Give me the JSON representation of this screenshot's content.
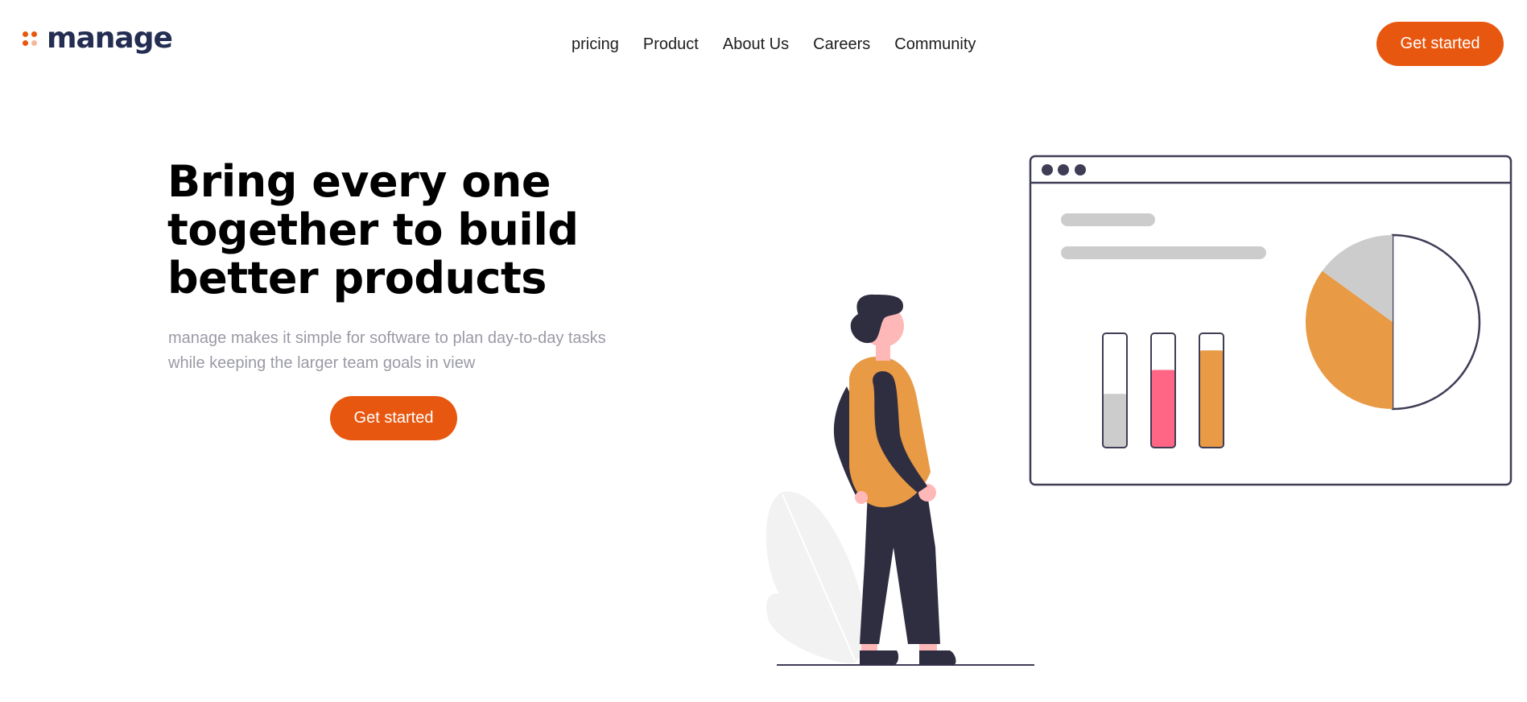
{
  "brand": {
    "name": "manage",
    "colors": {
      "primary": "#e8570f",
      "dark": "#242d52",
      "dot_light": "#f7b89a"
    }
  },
  "nav": {
    "items": [
      {
        "label": "pricing"
      },
      {
        "label": "Product"
      },
      {
        "label": "About Us"
      },
      {
        "label": "Careers"
      },
      {
        "label": "Community"
      }
    ],
    "cta_label": "Get started"
  },
  "hero": {
    "title_lines": [
      "Bring every one",
      "together to build",
      "better products"
    ],
    "subtitle_lines": [
      "manage makes it simple for software to plan day-to-day tasks",
      "while keeping the larger team goals in view"
    ],
    "cta_label": "Get started"
  },
  "illustration": {
    "dashboard_bars": [
      {
        "fill_fraction": 0.47,
        "color": "#cccccc"
      },
      {
        "fill_fraction": 0.68,
        "color": "#ff6584"
      },
      {
        "fill_fraction": 0.85,
        "color": "#e89a45"
      }
    ],
    "pie": {
      "slices": [
        {
          "fraction": 0.5,
          "color": "#ffffff"
        },
        {
          "fraction": 0.35,
          "color": "#e89a45"
        },
        {
          "fraction": 0.15,
          "color": "#cccccc"
        }
      ]
    }
  }
}
